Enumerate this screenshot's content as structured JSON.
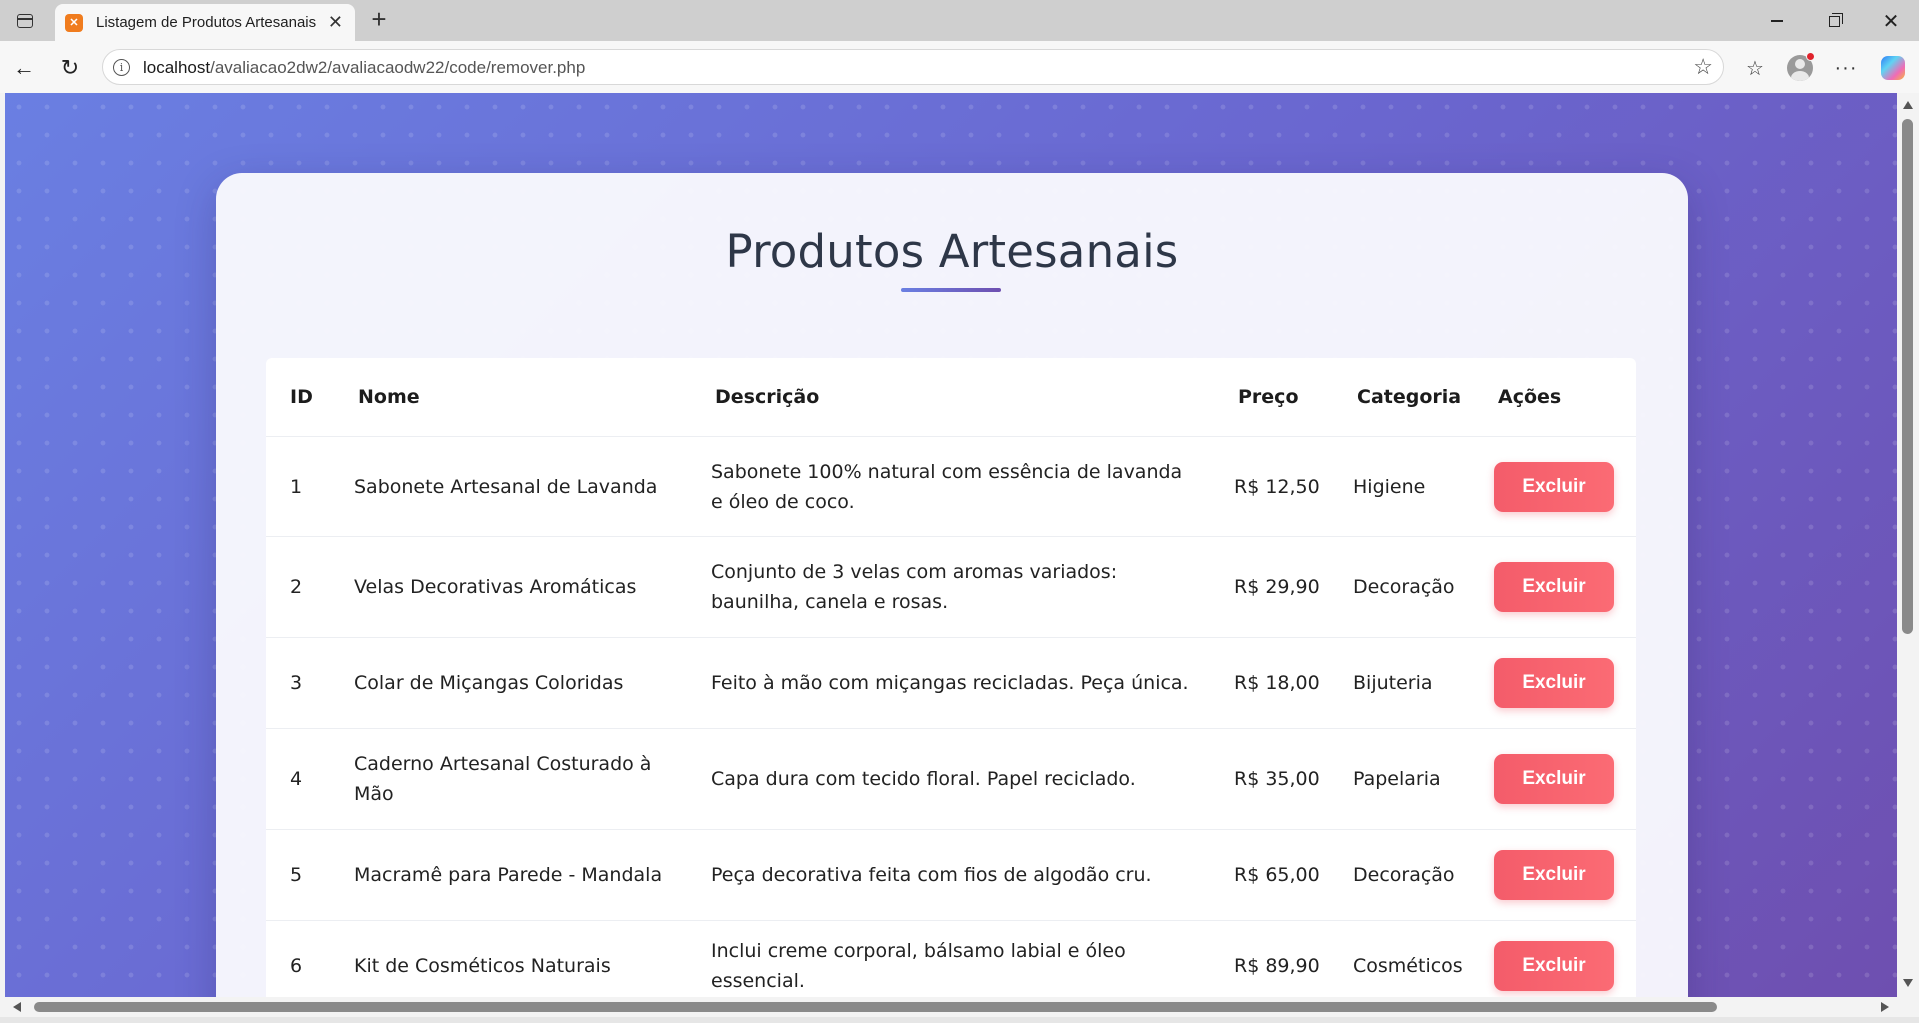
{
  "browser": {
    "tab_title": "Listagem de Produtos Artesanais",
    "tab_favicon": "xampp-icon",
    "url_host": "localhost",
    "url_path": "/avaliacao2dw2/avaliacaodw22/code/remover.php"
  },
  "page": {
    "title": "Produtos Artesanais",
    "accent_colors": [
      "#6a7fe2",
      "#6e4fb0"
    ],
    "delete_color": "#f45c6a"
  },
  "table": {
    "headers": {
      "id": "ID",
      "name": "Nome",
      "description": "Descrição",
      "price": "Preço",
      "category": "Categoria",
      "actions": "Ações"
    },
    "rows": [
      {
        "id": "1",
        "name": "Sabonete Artesanal de Lavanda",
        "description": "Sabonete 100% natural com essência de lavanda e óleo de coco.",
        "price": "R$ 12,50",
        "category": "Higiene",
        "action": "Excluir"
      },
      {
        "id": "2",
        "name": "Velas Decorativas Aromáticas",
        "description": "Conjunto de 3 velas com aromas variados: baunilha, canela e rosas.",
        "price": "R$ 29,90",
        "category": "Decoração",
        "action": "Excluir"
      },
      {
        "id": "3",
        "name": "Colar de Miçangas Coloridas",
        "description": "Feito à mão com miçangas recicladas. Peça única.",
        "price": "R$ 18,00",
        "category": "Bijuteria",
        "action": "Excluir"
      },
      {
        "id": "4",
        "name": "Caderno Artesanal Costurado à Mão",
        "description": "Capa dura com tecido floral. Papel reciclado.",
        "price": "R$ 35,00",
        "category": "Papelaria",
        "action": "Excluir"
      },
      {
        "id": "5",
        "name": "Macramê para Parede - Mandala",
        "description": "Peça decorativa feita com fios de algodão cru.",
        "price": "R$ 65,00",
        "category": "Decoração",
        "action": "Excluir"
      },
      {
        "id": "6",
        "name": "Kit de Cosméticos Naturais",
        "description": "Inclui creme corporal, bálsamo labial e óleo essencial.",
        "price": "R$ 89,90",
        "category": "Cosméticos",
        "action": "Excluir"
      }
    ]
  }
}
